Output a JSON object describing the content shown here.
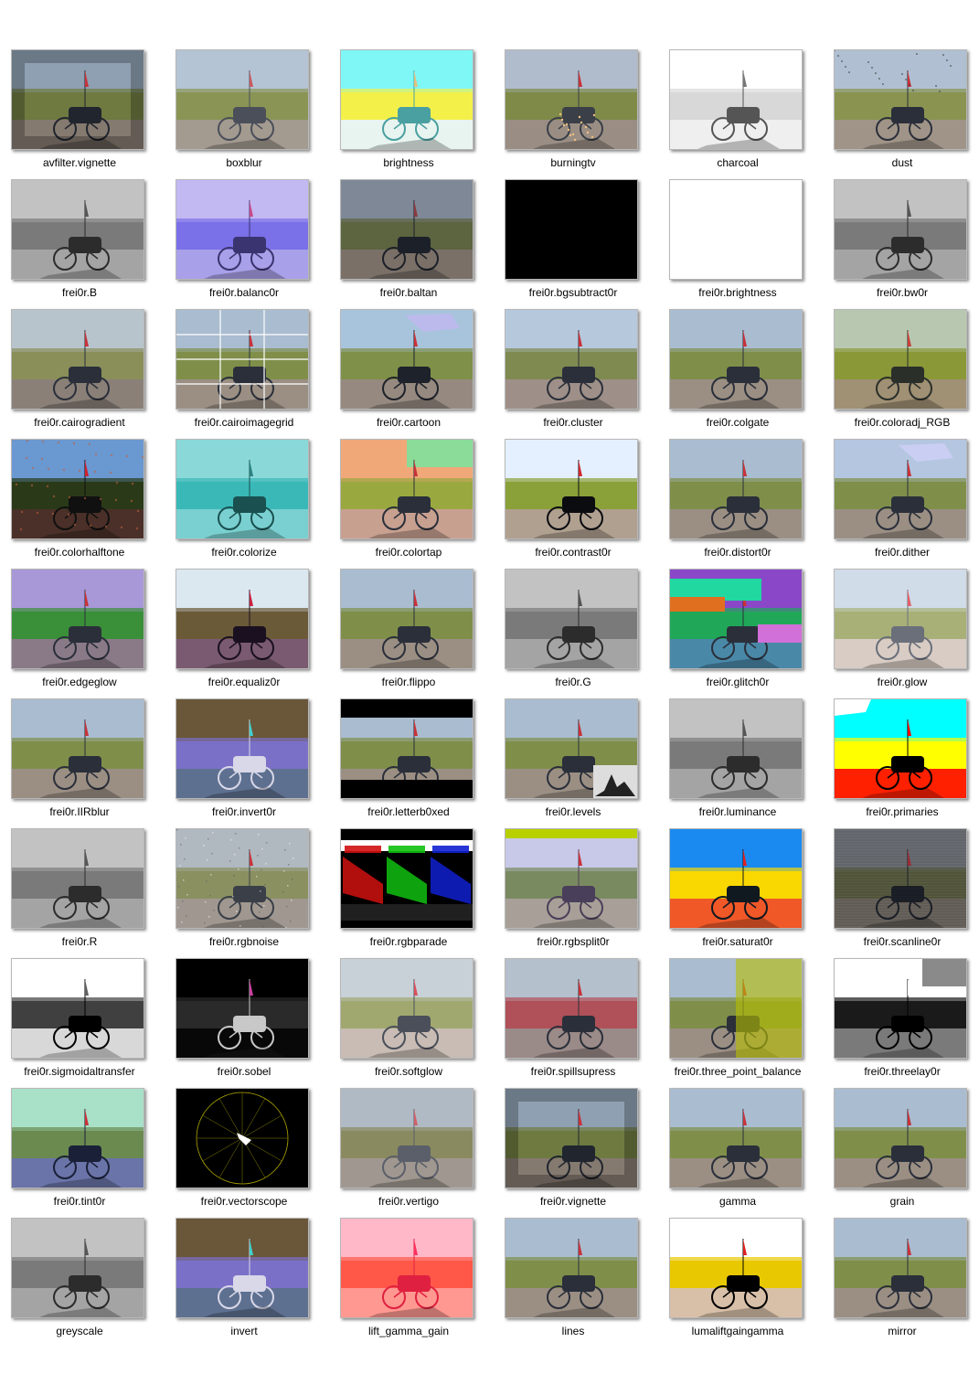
{
  "files": [
    {
      "name": "avfilter.vignette",
      "look": "vignette"
    },
    {
      "name": "boxblur",
      "look": "blur"
    },
    {
      "name": "brightness",
      "look": "brightcyan"
    },
    {
      "name": "burningtv",
      "look": "burning"
    },
    {
      "name": "charcoal",
      "look": "charcoal"
    },
    {
      "name": "dust",
      "look": "dust"
    },
    {
      "name": "frei0r.B",
      "look": "gray"
    },
    {
      "name": "frei0r.balanc0r",
      "look": "purple"
    },
    {
      "name": "frei0r.baltan",
      "look": "dark"
    },
    {
      "name": "frei0r.bgsubtract0r",
      "look": "black"
    },
    {
      "name": "frei0r.brightness",
      "look": "white"
    },
    {
      "name": "frei0r.bw0r",
      "look": "gray"
    },
    {
      "name": "frei0r.cairogradient",
      "look": "faded"
    },
    {
      "name": "frei0r.cairoimagegrid",
      "look": "imagegrid"
    },
    {
      "name": "frei0r.cartoon",
      "look": "cartoon"
    },
    {
      "name": "frei0r.cluster",
      "look": "cluster"
    },
    {
      "name": "frei0r.colgate",
      "look": "normal"
    },
    {
      "name": "frei0r.coloradj_RGB",
      "look": "warm"
    },
    {
      "name": "frei0r.colorhalftone",
      "look": "halftone"
    },
    {
      "name": "frei0r.colorize",
      "look": "cyan"
    },
    {
      "name": "frei0r.colortap",
      "look": "colortap"
    },
    {
      "name": "frei0r.contrast0r",
      "look": "contrast"
    },
    {
      "name": "frei0r.distort0r",
      "look": "normal"
    },
    {
      "name": "frei0r.dither",
      "look": "dither"
    },
    {
      "name": "frei0r.edgeglow",
      "look": "edgeglow"
    },
    {
      "name": "frei0r.equaliz0r",
      "look": "equalize"
    },
    {
      "name": "frei0r.flippo",
      "look": "normal"
    },
    {
      "name": "frei0r.G",
      "look": "gray"
    },
    {
      "name": "frei0r.glitch0r",
      "look": "glitch"
    },
    {
      "name": "frei0r.glow",
      "look": "glow"
    },
    {
      "name": "frei0r.IIRblur",
      "look": "normal"
    },
    {
      "name": "frei0r.invert0r",
      "look": "invert"
    },
    {
      "name": "frei0r.letterb0xed",
      "look": "letterbox"
    },
    {
      "name": "frei0r.levels",
      "look": "levels"
    },
    {
      "name": "frei0r.luminance",
      "look": "gray"
    },
    {
      "name": "frei0r.primaries",
      "look": "primaries"
    },
    {
      "name": "frei0r.R",
      "look": "gray"
    },
    {
      "name": "frei0r.rgbnoise",
      "look": "noise"
    },
    {
      "name": "frei0r.rgbparade",
      "look": "parade"
    },
    {
      "name": "frei0r.rgbsplit0r",
      "look": "rgbsplit"
    },
    {
      "name": "frei0r.saturat0r",
      "look": "saturate"
    },
    {
      "name": "frei0r.scanline0r",
      "look": "scanline"
    },
    {
      "name": "frei0r.sigmoidaltransfer",
      "look": "sigmoid"
    },
    {
      "name": "frei0r.sobel",
      "look": "sobel"
    },
    {
      "name": "frei0r.softglow",
      "look": "softglow"
    },
    {
      "name": "frei0r.spillsupress",
      "look": "spill"
    },
    {
      "name": "frei0r.three_point_balance",
      "look": "threepoint"
    },
    {
      "name": "frei0r.threelay0r",
      "look": "threelay"
    },
    {
      "name": "frei0r.tint0r",
      "look": "tint"
    },
    {
      "name": "frei0r.vectorscope",
      "look": "vectorscope"
    },
    {
      "name": "frei0r.vertigo",
      "look": "vertigo"
    },
    {
      "name": "frei0r.vignette",
      "look": "vignette"
    },
    {
      "name": "gamma",
      "look": "normal"
    },
    {
      "name": "grain",
      "look": "normal"
    },
    {
      "name": "greyscale",
      "look": "gray"
    },
    {
      "name": "invert",
      "look": "invert"
    },
    {
      "name": "lift_gamma_gain",
      "look": "pink"
    },
    {
      "name": "lines",
      "look": "normal"
    },
    {
      "name": "lumaliftgaingamma",
      "look": "luma"
    },
    {
      "name": "mirror",
      "look": "normal"
    }
  ]
}
